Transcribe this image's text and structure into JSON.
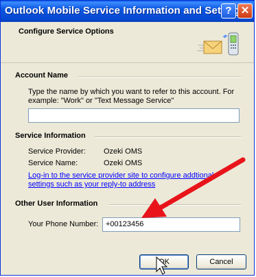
{
  "window": {
    "title": "Outlook Mobile Service Information and Settings",
    "help_label": "?",
    "close_label": "✕"
  },
  "header": {
    "title": "Configure Service Options",
    "icon": "envelope-to-phone-icon"
  },
  "account": {
    "heading": "Account Name",
    "description": "Type the name by which you want to refer to this account. For example: \"Work\" or \"Text Message Service\"",
    "value": ""
  },
  "service": {
    "heading": "Service Information",
    "provider_label": "Service Provider:",
    "provider_value": "Ozeki OMS",
    "name_label": "Service Name:",
    "name_value": "Ozeki OMS",
    "link_text": "Log-in to the service provider site to configure addtional settings such as your reply-to address"
  },
  "other": {
    "heading": "Other User Information",
    "phone_label": "Your Phone Number:",
    "phone_value": "+00123456"
  },
  "buttons": {
    "ok": "OK",
    "cancel": "Cancel"
  },
  "colors": {
    "annotation_arrow": "#e8141a",
    "titlebar": "#0a56e0",
    "link": "#0000ff"
  }
}
